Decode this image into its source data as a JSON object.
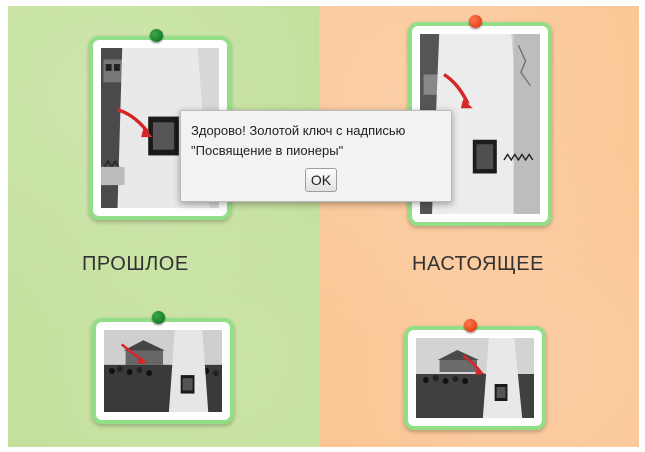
{
  "labels": {
    "past": "ПРОШЛОЕ",
    "present": "НАСТОЯЩЕЕ"
  },
  "dialog": {
    "line1": "Здорово! Золотой ключ с надписью",
    "line2": "\"Посвящение в пионеры\"",
    "ok_label": "OK"
  },
  "colors": {
    "past_background": "#c4e09c",
    "present_background": "#fbc695",
    "card_border": "#93df87",
    "pin_green": "#13892a",
    "pin_red": "#f24a1c",
    "arrow": "#d6262a"
  }
}
